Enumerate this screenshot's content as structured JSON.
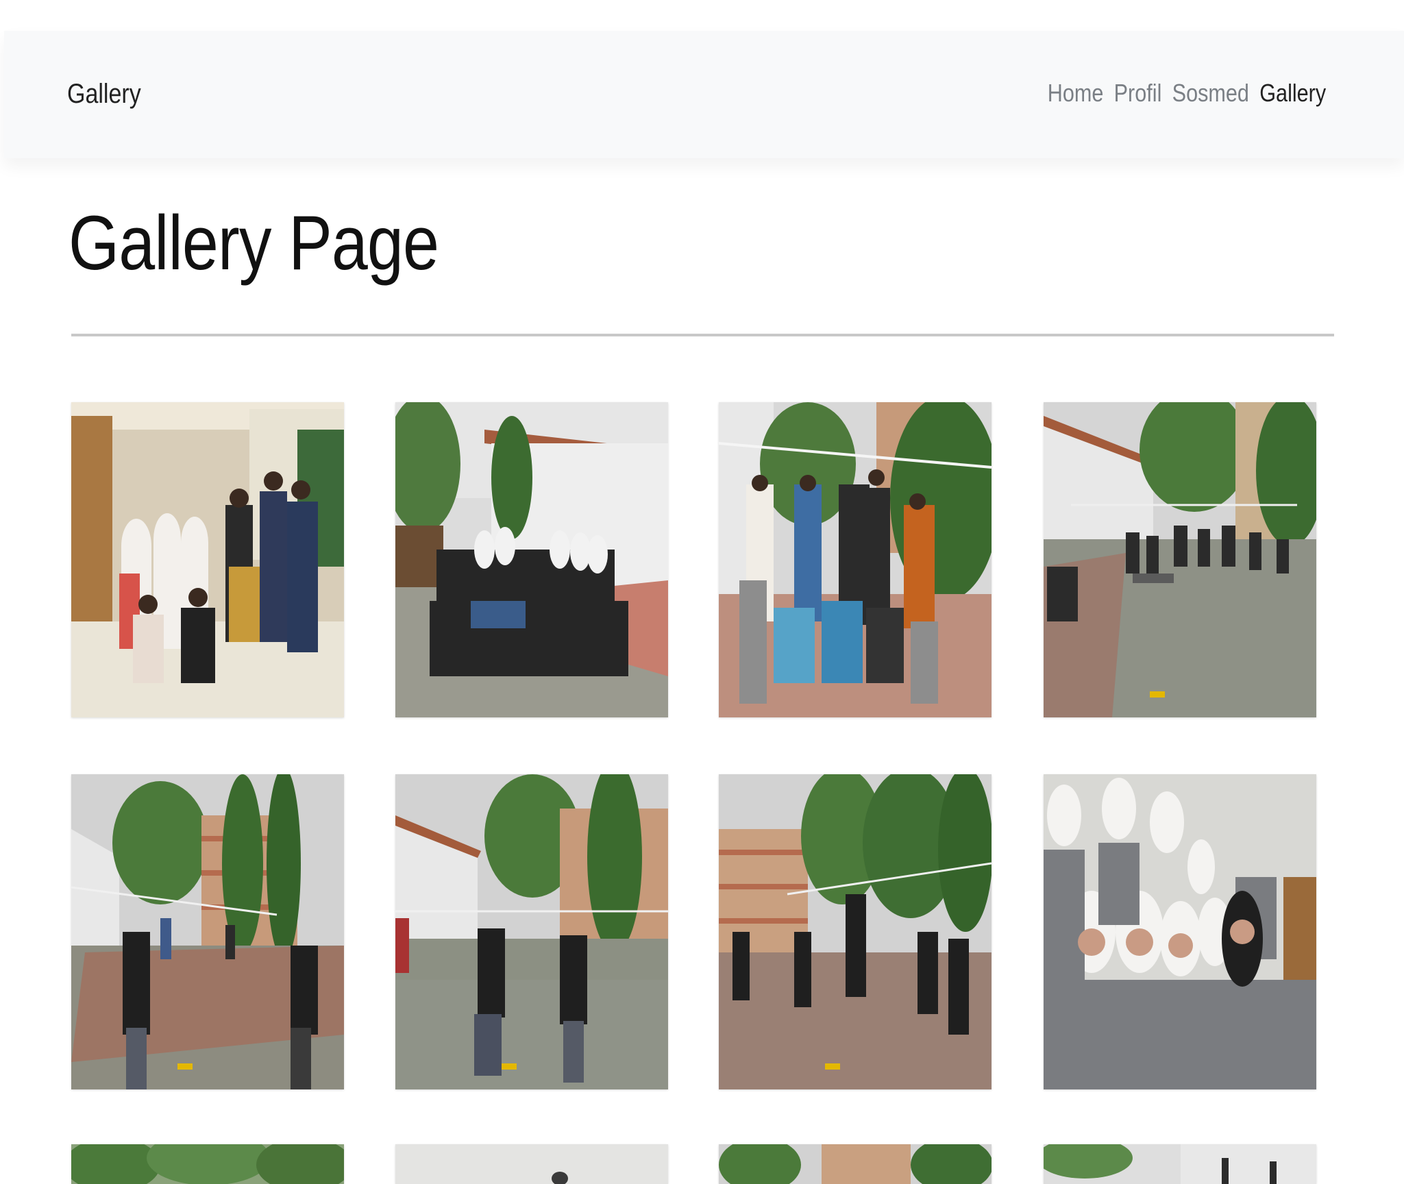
{
  "navbar": {
    "brand": "Gallery",
    "links": [
      "Home",
      "Profil",
      "Sosmed",
      "Gallery"
    ]
  },
  "page": {
    "title": "Gallery Page"
  },
  "gallery": {
    "photos": [
      {
        "scene": "group-indoor-stairs"
      },
      {
        "scene": "group-courtyard"
      },
      {
        "scene": "group-volleyball-net"
      },
      {
        "scene": "volleyball-match-wide"
      },
      {
        "scene": "volleyball-match-players-back"
      },
      {
        "scene": "volleyball-match-players-back-2"
      },
      {
        "scene": "volleyball-match-near-building"
      },
      {
        "scene": "group-girls-hijab"
      },
      {
        "scene": "trees-partial"
      },
      {
        "scene": "wall-partial"
      },
      {
        "scene": "building-trees-partial"
      },
      {
        "scene": "palm-building-partial"
      }
    ]
  }
}
